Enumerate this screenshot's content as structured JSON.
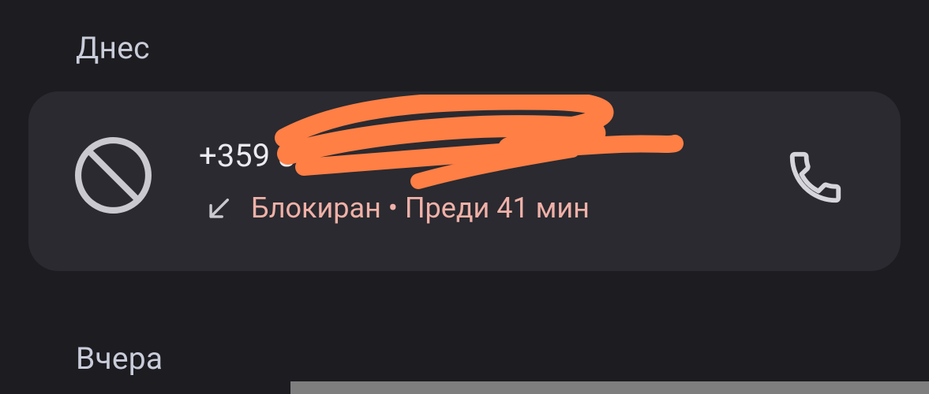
{
  "sections": {
    "today": "Днес",
    "yesterday": "Вчера"
  },
  "call": {
    "number_visible": "+359 8",
    "status": "Блокиран • Преди 41 мин",
    "icon_blocked": "blocked-icon",
    "icon_direction": "incoming-arrow-icon",
    "icon_action": "phone-icon"
  },
  "colors": {
    "background": "#1c1c21",
    "card": "#2a2a30",
    "status": "#f0b1a8",
    "scribble": "#ff7f45"
  }
}
